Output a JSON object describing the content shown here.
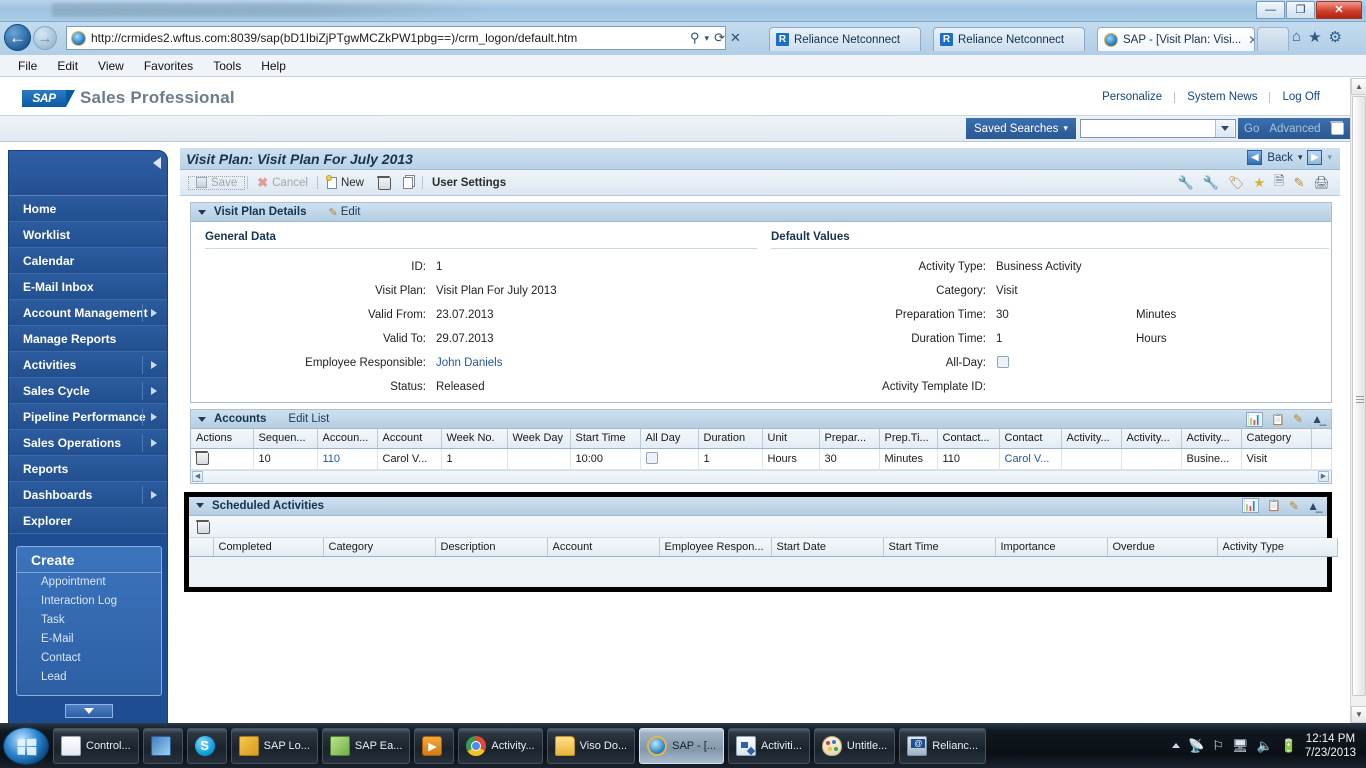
{
  "window": {
    "minimize": "—",
    "maximize": "❐",
    "close": "✕"
  },
  "browser": {
    "back_icon": "←",
    "forward_icon": "→",
    "url": "http://crmides2.wftus.com:8039/sap(bD1IbiZjPTgwMCZkPW1pbg==)/crm_logon/default.htm",
    "url_host_bold": "wftus.com",
    "search_icon": "⚲",
    "refresh_icon": "⟳",
    "stop_icon": "✕",
    "tabs": [
      {
        "label": "Reliance Netconnect",
        "icon": "R",
        "active": false
      },
      {
        "label": "Reliance Netconnect",
        "icon": "R",
        "active": false
      },
      {
        "label": "SAP - [Visit Plan: Visi...",
        "icon": "e",
        "active": true,
        "close": "✕"
      }
    ],
    "toolbar_icons": [
      {
        "name": "home-icon",
        "glyph": "⌂"
      },
      {
        "name": "favorites-star-icon",
        "glyph": "★"
      },
      {
        "name": "tools-gear-icon",
        "glyph": "⚙"
      }
    ],
    "menu": [
      "File",
      "Edit",
      "View",
      "Favorites",
      "Tools",
      "Help"
    ]
  },
  "sap": {
    "logo": "SAP",
    "app_name": "Sales Professional",
    "top_links": [
      "Personalize",
      "System News",
      "Log Off"
    ],
    "search": {
      "saved_searches_label": "Saved Searches",
      "dropdown_caret": "▾",
      "value": "",
      "placeholder": "",
      "go_label": "Go",
      "advanced_label": "Advanced",
      "delete_icon": "trash-icon"
    },
    "sidebar": {
      "collapse_icon": "collapse-arrow-icon",
      "items": [
        {
          "label": "Home",
          "has_arrow": false
        },
        {
          "label": "Worklist",
          "has_arrow": false
        },
        {
          "label": "Calendar",
          "has_arrow": false
        },
        {
          "label": "E-Mail Inbox",
          "has_arrow": false
        },
        {
          "label": "Account Management",
          "has_arrow": true
        },
        {
          "label": "Manage Reports",
          "has_arrow": false
        },
        {
          "label": "Activities",
          "has_arrow": true
        },
        {
          "label": "Sales Cycle",
          "has_arrow": true
        },
        {
          "label": "Pipeline Performance",
          "has_arrow": true
        },
        {
          "label": "Sales Operations",
          "has_arrow": true
        },
        {
          "label": "Reports",
          "has_arrow": false
        },
        {
          "label": "Dashboards",
          "has_arrow": true
        },
        {
          "label": "Explorer",
          "has_arrow": false
        }
      ],
      "create": {
        "title": "Create",
        "links": [
          "Appointment",
          "Interaction Log",
          "Task",
          "E-Mail",
          "Contact",
          "Lead"
        ]
      }
    },
    "content": {
      "title": "Visit Plan: Visit Plan For July 2013",
      "back_label": "Back",
      "back_caret": "▾",
      "forward_caret": "▾",
      "actions": [
        {
          "label": "Save",
          "icon": "save-disk-icon",
          "disabled": true
        },
        {
          "label": "Cancel",
          "icon": "cancel-x-icon",
          "disabled": true
        },
        {
          "label": "New",
          "icon": "new-page-icon",
          "disabled": false
        },
        {
          "label": "",
          "icon": "delete-trash-icon",
          "disabled": false
        },
        {
          "label": "",
          "icon": "copy-icon",
          "disabled": false
        },
        {
          "label": "User Settings",
          "icon": "",
          "disabled": false
        }
      ],
      "toolbar_icons": [
        "wrench-screwdriver-icon",
        "wrench-icon",
        "tag-icon",
        "favorite-star-add-icon",
        "notes-icon",
        "edit-pencil-icon",
        "print-icon"
      ]
    },
    "details_panel": {
      "title": "Visit Plan Details",
      "edit_label": "Edit",
      "edit_icon": "edit-pencil-icon",
      "general_data": {
        "heading": "General Data",
        "fields": [
          {
            "label": "ID:",
            "value": "1",
            "link": false
          },
          {
            "label": "Visit Plan:",
            "value": "Visit Plan For July 2013",
            "link": false
          },
          {
            "label": "Valid From:",
            "value": "23.07.2013",
            "link": false
          },
          {
            "label": "Valid To:",
            "value": "29.07.2013",
            "link": false
          },
          {
            "label": "Employee Responsible:",
            "value": "John Daniels",
            "link": true
          },
          {
            "label": "Status:",
            "value": "Released",
            "link": false
          }
        ]
      },
      "default_values": {
        "heading": "Default Values",
        "fields": [
          {
            "label": "Activity Type:",
            "value": "Business Activity",
            "unit": ""
          },
          {
            "label": "Category:",
            "value": "Visit",
            "unit": ""
          },
          {
            "label": "Preparation Time:",
            "value": "30",
            "unit": "Minutes"
          },
          {
            "label": "Duration Time:",
            "value": "1",
            "unit": "Hours"
          },
          {
            "label": "All-Day:",
            "value": "",
            "unit": "",
            "checkbox": true,
            "checked": false
          },
          {
            "label": "Activity Template ID:",
            "value": "",
            "unit": ""
          }
        ]
      }
    },
    "accounts_panel": {
      "title": "Accounts",
      "edit_list_label": "Edit List",
      "icons": [
        "chart-bar-icon",
        "export-spreadsheet-icon",
        "edit-pencil-icon",
        "collapse-icon"
      ],
      "columns": [
        "Actions",
        "Sequen...",
        "Accoun...",
        "Account",
        "Week No.",
        "Week Day",
        "Start Time",
        "All Day",
        "Duration",
        "Unit",
        "Prepar...",
        "Prep.Ti...",
        "Contact...",
        "Contact",
        "Activity...",
        "Activity...",
        "Activity...",
        "Category"
      ],
      "rows": [
        {
          "actions": "delete-trash-icon",
          "sequence": "10",
          "account_id": "110",
          "account": "Carol V...",
          "week_no": "1",
          "week_day": "",
          "start_time": "10:00",
          "all_day": false,
          "duration": "1",
          "unit": "Hours",
          "preparation": "30",
          "prep_time_unit": "Minutes",
          "contact_id": "110",
          "contact": "Carol V...",
          "activity_1": "",
          "activity_2": "",
          "activity_3": "Busine...",
          "category": "Visit"
        }
      ],
      "scroll_left_icon": "◀",
      "scroll_right_icon": "▶"
    },
    "scheduled_panel": {
      "title": "Scheduled Activities",
      "delete_icon": "delete-trash-icon",
      "icons": [
        "chart-bar-icon",
        "export-spreadsheet-icon",
        "edit-pencil-icon",
        "collapse-icon"
      ],
      "columns": [
        "",
        "Completed",
        "Category",
        "Description",
        "Account",
        "Employee Respon...",
        "Start Date",
        "Start Time",
        "Importance",
        "Overdue",
        "Activity Type"
      ],
      "rows": []
    }
  },
  "taskbar": {
    "start_label": "Start",
    "buttons": [
      {
        "label": "Control...",
        "icon": "word-document-icon",
        "active": false
      },
      {
        "label": "",
        "icon": "remote-desktop-icon",
        "active": false
      },
      {
        "label": "",
        "icon": "skype-icon",
        "active": false
      },
      {
        "label": "SAP Lo...",
        "icon": "sap-logon-icon",
        "active": false
      },
      {
        "label": "SAP Ea...",
        "icon": "sap-easy-access-icon",
        "active": false
      },
      {
        "label": "",
        "icon": "media-player-icon",
        "active": false
      },
      {
        "label": "Activity...",
        "icon": "chrome-icon",
        "active": false
      },
      {
        "label": "Viso Do...",
        "icon": "folder-icon",
        "active": false
      },
      {
        "label": "SAP - [...",
        "icon": "internet-explorer-icon",
        "active": true
      },
      {
        "label": "Activiti...",
        "icon": "visio-icon",
        "active": false
      },
      {
        "label": "Untitle...",
        "icon": "paint-icon",
        "active": false
      },
      {
        "label": "Relianc...",
        "icon": "reliance-modem-icon",
        "active": false
      }
    ],
    "tray": {
      "show_hidden_icon": "▲",
      "icons": [
        "network-monitor-icon",
        "flag-action-center-icon",
        "network-icon",
        "volume-icon",
        "battery-icon"
      ],
      "time": "12:14 PM",
      "date": "7/23/2013"
    }
  }
}
